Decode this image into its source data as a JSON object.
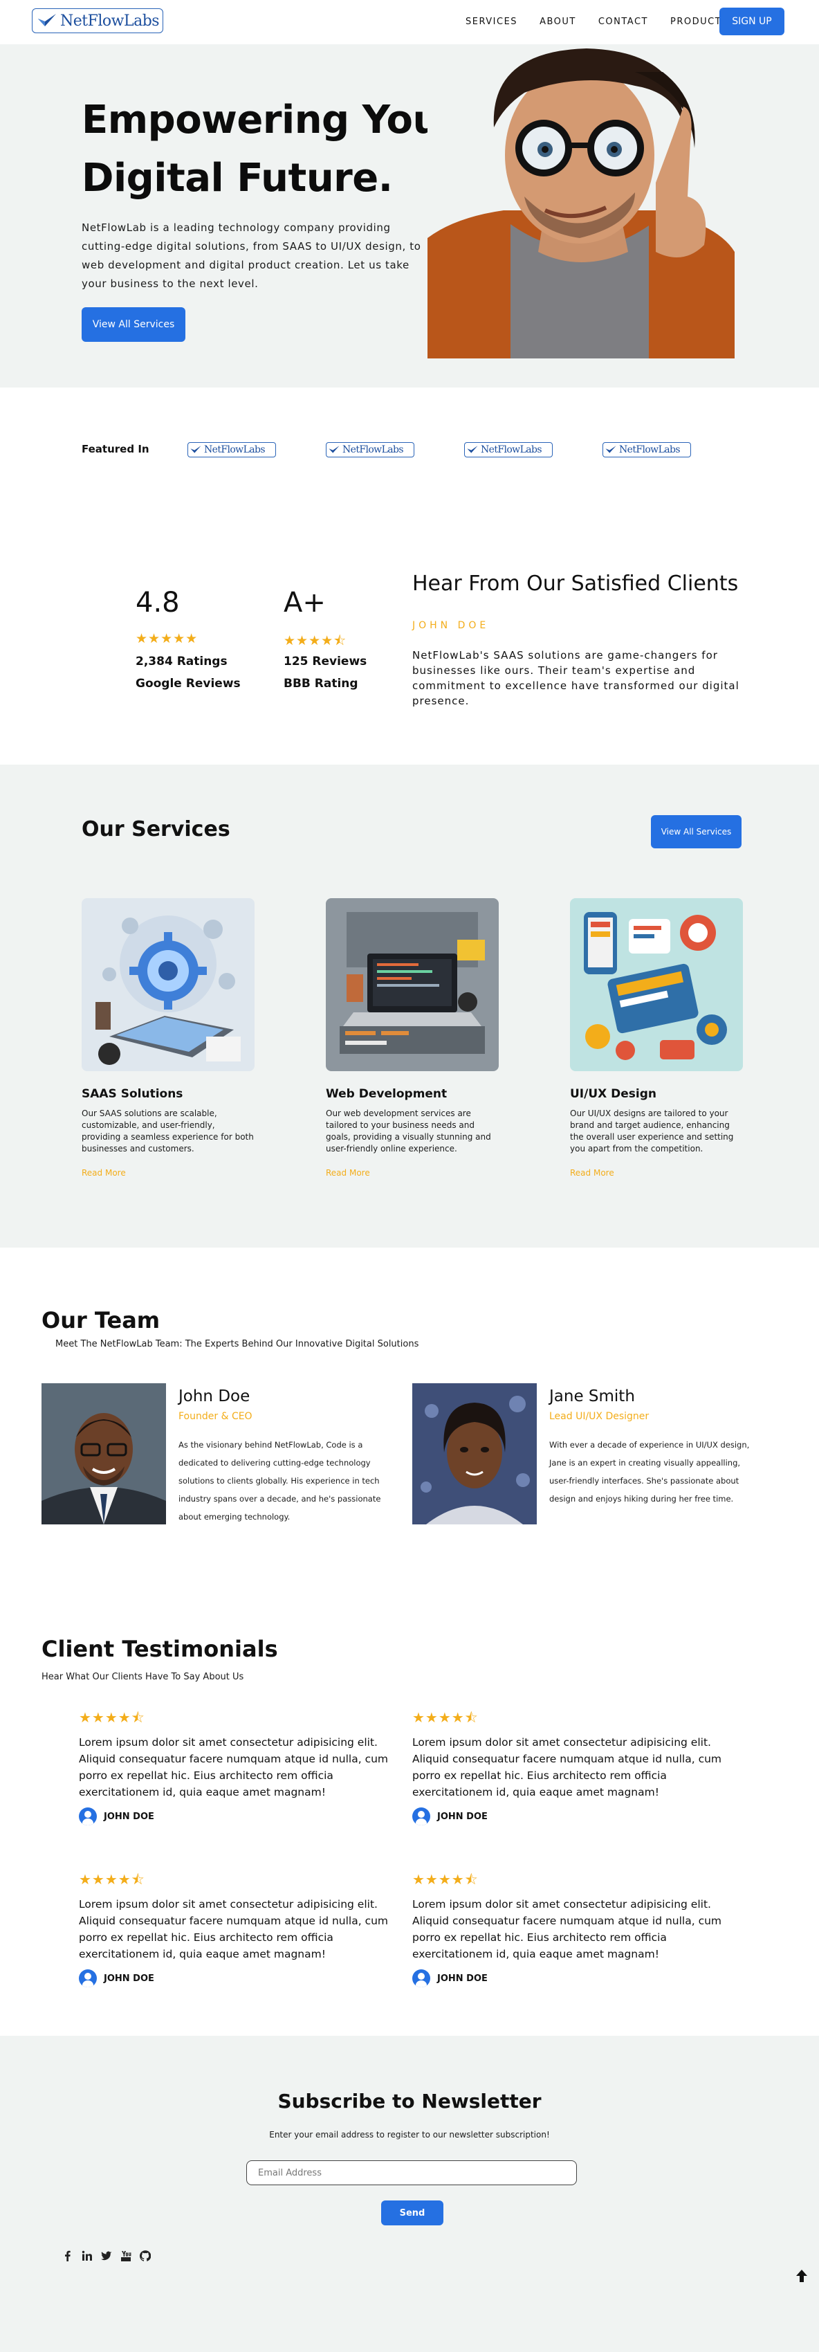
{
  "nav": {
    "logo_text": "NetFlowLabs",
    "links": [
      "SERVICES",
      "ABOUT",
      "CONTACT",
      "PRODUCTS"
    ],
    "signup_label": "SIGN UP"
  },
  "hero": {
    "title_line1": "Empowering Your",
    "title_line2": "Digital Future.",
    "description": "NetFlowLab is a leading technology company providing cutting-edge digital solutions, from SAAS to UI/UX design, to web development and digital product creation. Let us take your business to the next level.",
    "cta_label": "View All Services"
  },
  "featured": {
    "label": "Featured In",
    "logos": [
      "NetFlowLabs",
      "NetFlowLabs",
      "NetFlowLabs",
      "NetFlowLabs"
    ]
  },
  "ratings": {
    "boxes": [
      {
        "score": "4.8",
        "stars": "★★★★★",
        "line1": "2,384 Ratings",
        "line2": "Google Reviews"
      },
      {
        "score": "A+",
        "stars": "★★★★⯪",
        "line1": "125 Reviews",
        "line2": "BBB Rating"
      }
    ],
    "heading": "Hear From Our Satisfied Clients",
    "author": "JOHN DOE",
    "quote": "NetFlowLab's SAAS solutions are game-changers for businesses like ours. Their team's expertise and commitment to excellence have transformed our digital presence."
  },
  "services": {
    "heading": "Our Services",
    "all_label": "View All Services",
    "items": [
      {
        "title": "SAAS Solutions",
        "text": "Our SAAS solutions are scalable, customizable, and user-friendly, providing a seamless experience for both businesses and customers.",
        "more": "Read More"
      },
      {
        "title": "Web Development",
        "text": "Our web development services are tailored to your business needs and goals, providing a visually stunning and user-friendly online experience.",
        "more": "Read More"
      },
      {
        "title": "UI/UX Design",
        "text": "Our UI/UX designs are tailored to your brand and target audience, enhancing the overall user experience and setting you apart from the competition.",
        "more": "Read More"
      }
    ]
  },
  "team": {
    "heading": "Our Team",
    "subheading": "Meet The NetFlowLab Team: The Experts Behind Our Innovative Digital Solutions",
    "members": [
      {
        "name": "John Doe",
        "role": "Founder & CEO",
        "bio": "As the visionary behind NetFlowLab, Code is a dedicated to delivering cutting-edge technology solutions to clients globally. His experience in tech industry spans over a decade, and he's passionate about emerging technology."
      },
      {
        "name": "Jane Smith",
        "role": "Lead UI/UX Designer",
        "bio": "With ever a decade of experience in UI/UX design, Jane is an expert in creating visually appealling, user-friendly interfaces. She's passionate about design and enjoys hiking during her free time."
      }
    ]
  },
  "testimonials": {
    "heading": "Client Testimonials",
    "subheading": "Hear What Our Clients Have To Say About Us",
    "items": [
      {
        "stars": "★★★★⯪",
        "text": "Lorem ipsum dolor sit amet consectetur adipisicing elit. Aliquid consequatur facere numquam atque id nulla, cum porro ex repellat hic. Eius architecto rem officia exercitationem id, quia eaque amet magnam!",
        "author": "JOHN DOE"
      },
      {
        "stars": "★★★★⯪",
        "text": "Lorem ipsum dolor sit amet consectetur adipisicing elit. Aliquid consequatur facere numquam atque id nulla, cum porro ex repellat hic. Eius architecto rem officia exercitationem id, quia eaque amet magnam!",
        "author": "JOHN DOE"
      },
      {
        "stars": "★★★★⯪",
        "text": "Lorem ipsum dolor sit amet consectetur adipisicing elit. Aliquid consequatur facere numquam atque id nulla, cum porro ex repellat hic. Eius architecto rem officia exercitationem id, quia eaque amet magnam!",
        "author": "JOHN DOE"
      },
      {
        "stars": "★★★★⯪",
        "text": "Lorem ipsum dolor sit amet consectetur adipisicing elit. Aliquid consequatur facere numquam atque id nulla, cum porro ex repellat hic. Eius architecto rem officia exercitationem id, quia eaque amet magnam!",
        "author": "JOHN DOE"
      }
    ]
  },
  "newsletter": {
    "heading": "Subscribe to Newsletter",
    "subheading": "Enter your email address to register to our newsletter subscription!",
    "email_placeholder": "Email Address",
    "send_label": "Send"
  },
  "social_icons": [
    "facebook-icon",
    "linkedin-icon",
    "twitter-icon",
    "youtube-icon",
    "github-icon"
  ],
  "colors": {
    "accent": "#2570e2",
    "gold": "#f3ad1a",
    "section_bg": "#f0f3f2",
    "brand_logo": "#1d4f9e"
  }
}
